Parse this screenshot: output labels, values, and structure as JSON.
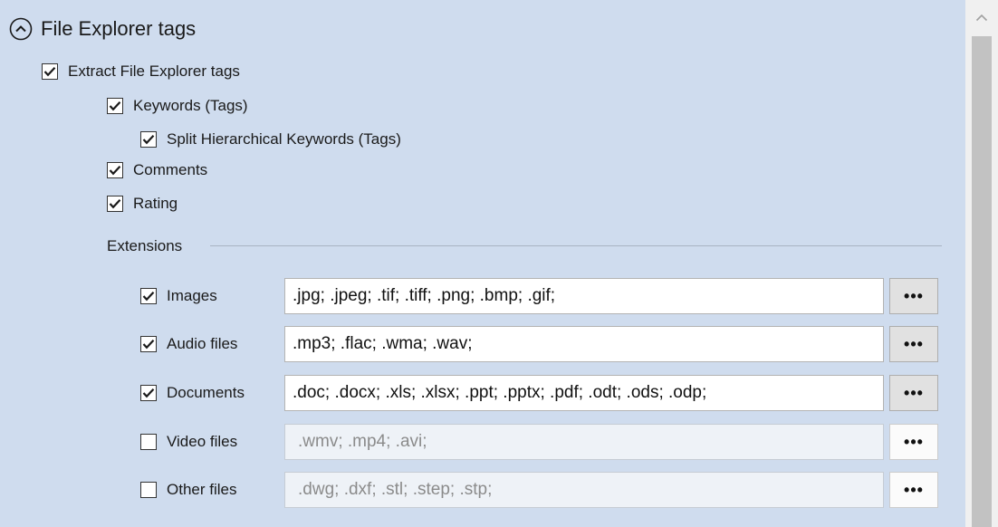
{
  "section": {
    "title": "File Explorer tags",
    "collapse_icon": "chevron-up-circle-icon"
  },
  "options": {
    "extract": {
      "label": "Extract File Explorer tags",
      "checked": true
    },
    "keywords": {
      "label": "Keywords (Tags)",
      "checked": true
    },
    "split_keywords": {
      "label": "Split Hierarchical Keywords (Tags)",
      "checked": true
    },
    "comments": {
      "label": "Comments",
      "checked": true
    },
    "rating": {
      "label": "Rating",
      "checked": true
    }
  },
  "extensions": {
    "label": "Extensions",
    "browse_label": "•••",
    "rows": [
      {
        "label": "Images",
        "checked": true,
        "value": ".jpg; .jpeg; .tif; .tiff; .png; .bmp; .gif;",
        "enabled": true
      },
      {
        "label": "Audio files",
        "checked": true,
        "value": ".mp3; .flac; .wma; .wav;",
        "enabled": true
      },
      {
        "label": "Documents",
        "checked": true,
        "value": ".doc; .docx; .xls; .xlsx; .ppt; .pptx; .pdf; .odt; .ods; .odp;",
        "enabled": true
      },
      {
        "label": "Video files",
        "checked": false,
        "value": ".wmv; .mp4; .avi;",
        "enabled": false
      },
      {
        "label": "Other files",
        "checked": false,
        "value": ".dwg; .dxf; .stl; .step; .stp;",
        "enabled": false
      }
    ]
  },
  "scrollbar": {
    "up_icon": "chevron-up-icon"
  }
}
